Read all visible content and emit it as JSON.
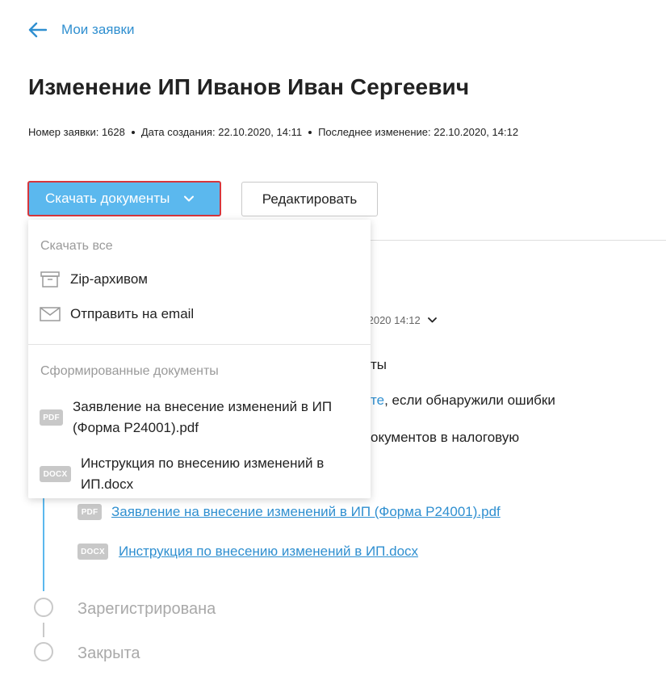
{
  "nav": {
    "back_label": "Мои заявки"
  },
  "header": {
    "title": "Изменение ИП Иванов Иван Сергеевич",
    "meta": {
      "number_label": "Номер заявки:",
      "number_value": "1628",
      "created_label": "Дата создания:",
      "created_value": "22.10.2020, 14:11",
      "modified_label": "Последнее изменение:",
      "modified_value": "22.10.2020, 14:12"
    }
  },
  "actions": {
    "download_label": "Скачать документы",
    "edit_label": "Редактировать"
  },
  "dropdown": {
    "section_all": "Скачать все",
    "zip_label": "Zip-архивом",
    "email_label": "Отправить на email",
    "section_generated": "Сформированные документы",
    "docs": [
      {
        "badge": "PDF",
        "line1": "Заявление на внесение изменений в ИП",
        "line2": "(Форма Р24001).pdf"
      },
      {
        "badge": "DOCX",
        "line1": "Инструкция по внесению изменений в",
        "line2": "ИП.docx"
      }
    ]
  },
  "background": {
    "date_fragment": ".2020 14:12",
    "text1": "ты",
    "text2_link": "те",
    "text2_rest": ", если обнаружили ошибки",
    "text3": "окументов в налоговую",
    "links": [
      {
        "badge": "PDF",
        "label": "Заявление на внесение изменений в ИП (Форма Р24001).pdf"
      },
      {
        "badge": "DOCX",
        "label": "Инструкция по внесению изменений в ИП.docx"
      }
    ]
  },
  "steps": [
    {
      "label": "Зарегистрирована"
    },
    {
      "label": "Закрыта"
    }
  ],
  "colors": {
    "accent": "#5bb8ee",
    "link": "#2f8fd0",
    "focus_border": "#d6363c",
    "muted": "#a9a9a9"
  }
}
